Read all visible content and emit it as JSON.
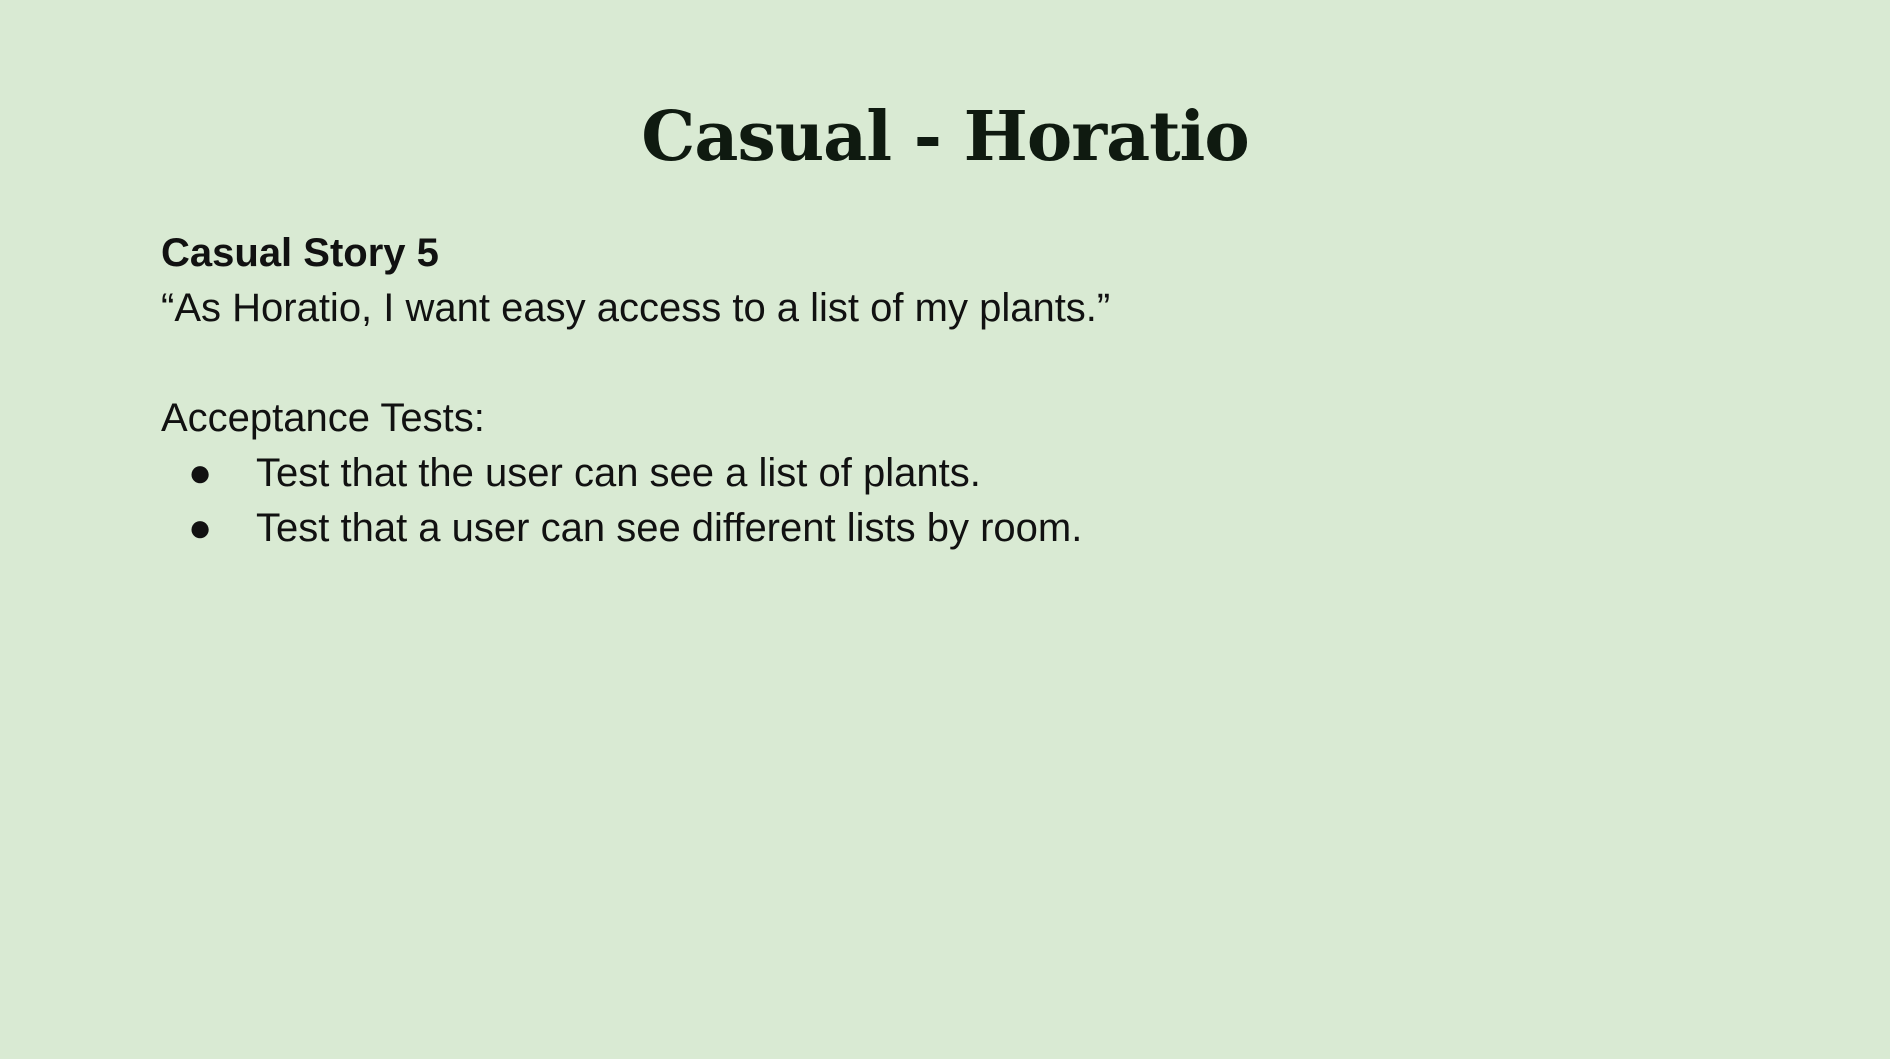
{
  "slide": {
    "title": "Casual - Horatio",
    "story_heading": "Casual Story 5",
    "story_quote": "“As Horatio, I want easy access to a list of my plants.”",
    "tests_label": "Acceptance Tests:",
    "bullet_glyph": "●",
    "tests": [
      "Test that the user can see a list of plants.",
      "Test that a user can see different lists by room."
    ]
  },
  "colors": {
    "background": "#d9ead3",
    "title": "#0f1a10",
    "text": "#111111"
  }
}
